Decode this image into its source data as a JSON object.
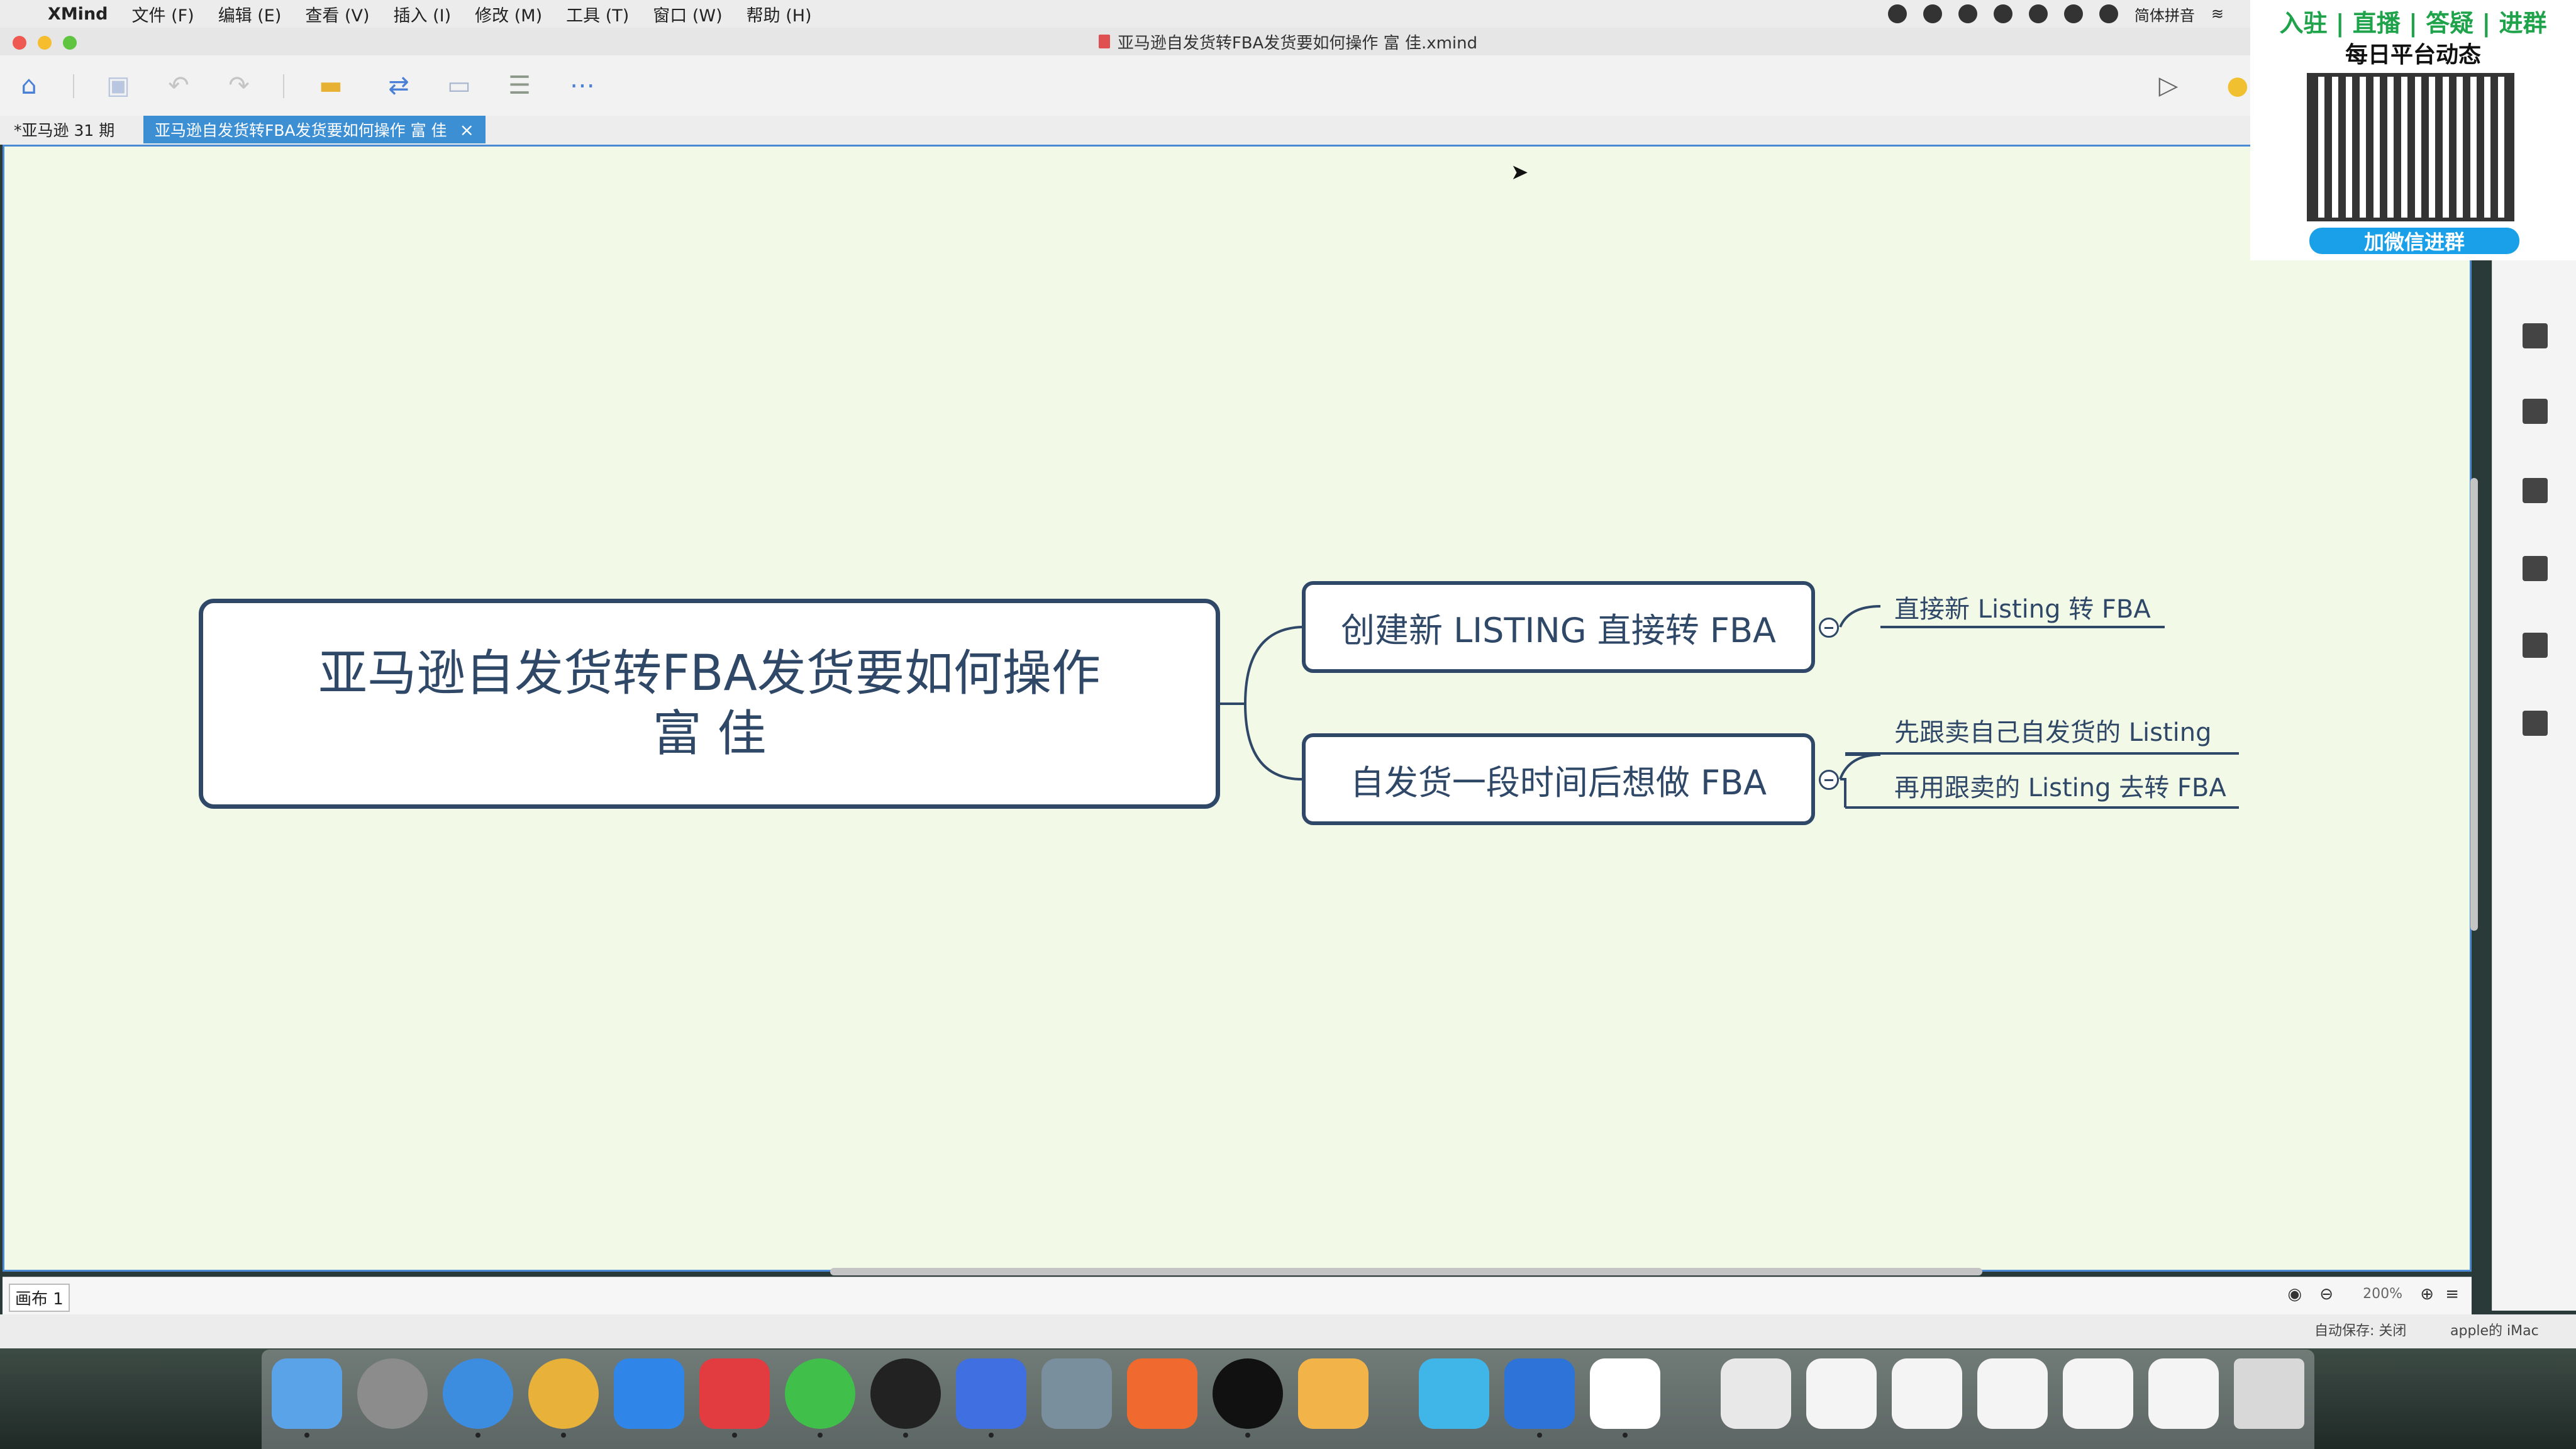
{
  "menubar": {
    "app_name": "XMind",
    "items": [
      "文件 (F)",
      "编辑 (E)",
      "查看 (V)",
      "插入 (I)",
      "修改 (M)",
      "工具 (T)",
      "窗口 (W)",
      "帮助 (H)"
    ],
    "input_method": "简体拼音"
  },
  "window": {
    "title": "亚马逊自发货转FBA发货要如何操作  富 佳.xmind"
  },
  "tabs": [
    {
      "label": "*亚马逊 31 期"
    },
    {
      "label": "亚马逊自发货转FBA发货要如何操作  富 佳"
    }
  ],
  "mindmap": {
    "central": {
      "line1": "亚马逊自发货转FBA发货要如何操作",
      "line2": "富 佳"
    },
    "topic1": {
      "label": "创建新 LISTING 直接转 FBA",
      "subs": [
        "直接新 Listing 转 FBA"
      ]
    },
    "topic2": {
      "label": "自发货一段时间后想做 FBA",
      "subs": [
        "先跟卖自己自发货的 Listing",
        "再用跟卖的 Listing 去转 FBA"
      ]
    }
  },
  "statusbar": {
    "sheet": "画布 1",
    "zoom": "200%",
    "autosave": "自动保存: 关闭",
    "user": "apple的 iMac"
  },
  "promo": {
    "title": "入驻 | 直播 | 答疑 | 进群",
    "subtitle": "每日平台动态",
    "button": "加微信进群"
  },
  "colors": {
    "canvas": "#f2f9e7",
    "topic_border": "#2f4868",
    "active_tab": "#3d8fd4",
    "promo_green": "#1ea34a",
    "promo_button": "#1aa0e8"
  },
  "icons": {
    "toolbar": [
      "home-icon",
      "save-icon",
      "undo-icon",
      "redo-icon",
      "topic-insert-icon",
      "relationship-icon",
      "boundary-icon",
      "summary-icon",
      "more-icon",
      "presentation-icon",
      "idea-icon"
    ],
    "right_panel": [
      "image-icon",
      "flag-icon",
      "format-icon",
      "notes-icon",
      "comment-icon",
      "task-icon"
    ]
  }
}
